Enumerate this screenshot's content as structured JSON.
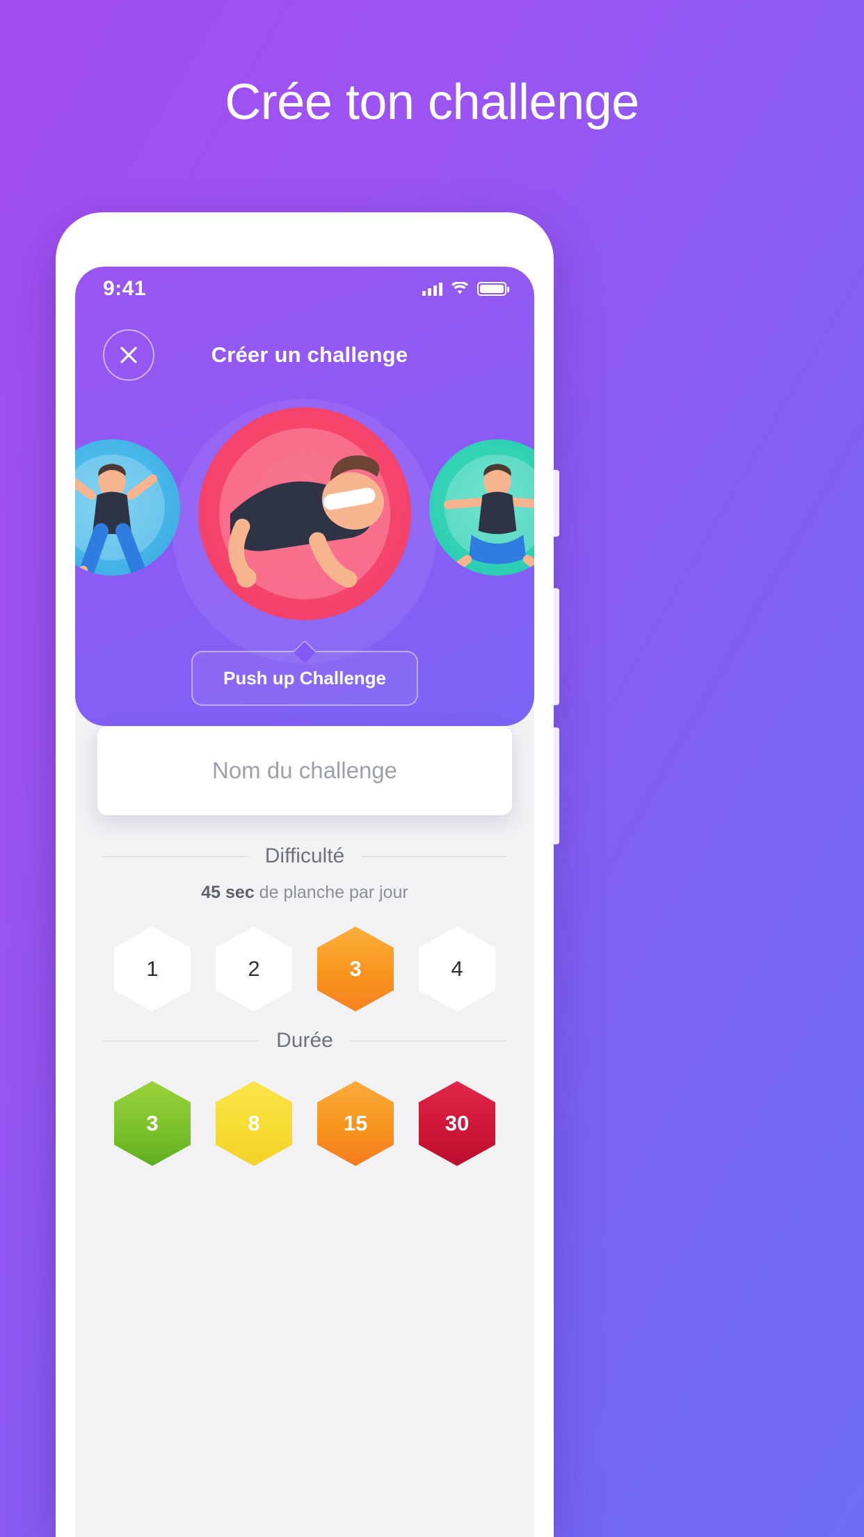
{
  "promo": {
    "headline": "Crée ton challenge"
  },
  "status_bar": {
    "time": "9:41",
    "signal_icon": "signal-bars-icon",
    "wifi_icon": "wifi-icon",
    "battery_icon": "battery-icon"
  },
  "nav": {
    "close_icon": "close-icon",
    "title": "Créer un challenge"
  },
  "carousel": {
    "items": [
      {
        "name": "jumping-jack-challenge",
        "color": "#45b6e8"
      },
      {
        "name": "push-up-challenge",
        "color": "#f6456b"
      },
      {
        "name": "yoga-challenge",
        "color": "#2ed0b4"
      }
    ],
    "selected_label": "Push up Challenge"
  },
  "name_input": {
    "placeholder": "Nom du challenge",
    "value": ""
  },
  "difficulty": {
    "heading": "Difficulté",
    "note_strong": "45 sec",
    "note_rest": " de planche par jour",
    "options": [
      {
        "label": "1",
        "selected": false
      },
      {
        "label": "2",
        "selected": false
      },
      {
        "label": "3",
        "selected": true
      },
      {
        "label": "4",
        "selected": false
      }
    ],
    "selected_color": "#f7941e"
  },
  "duration": {
    "heading": "Durée",
    "options": [
      {
        "label": "3",
        "color": "#7cc22b"
      },
      {
        "label": "8",
        "color": "#f7dc32"
      },
      {
        "label": "15",
        "color": "#f7941e"
      },
      {
        "label": "30",
        "color": "#cf1638"
      }
    ]
  },
  "colors": {
    "background_start": "#a34ef0",
    "background_end": "#6e6cf7",
    "hero_purple": "#8d5bf4",
    "screen_bg": "#f2f2f4"
  }
}
